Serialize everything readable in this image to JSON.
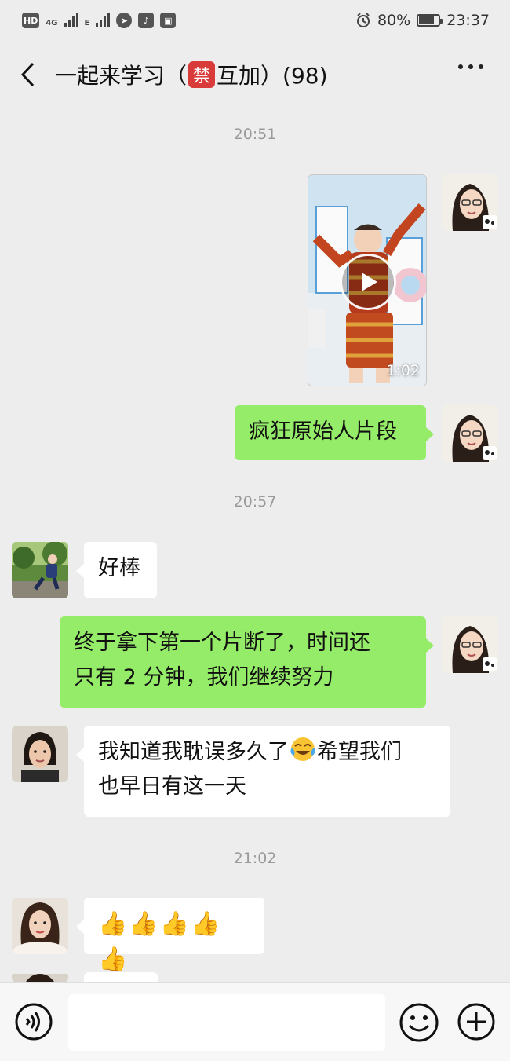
{
  "status_bar": {
    "hd": "HD",
    "net_a": "4G",
    "net_b": "E",
    "battery": "80%",
    "time": "23:37"
  },
  "header": {
    "title_before": "一起来学习（",
    "ban_badge": "禁",
    "title_after": "互加）(98)"
  },
  "chat": {
    "timestamps": [
      "20:51",
      "20:57",
      "21:02"
    ],
    "video": {
      "duration": "1:02"
    },
    "messages": [
      {
        "text": "疯狂原始人片段"
      },
      {
        "text": "好棒"
      },
      {
        "line1": "终于拿下第一个片断了，时间还",
        "line2": "只有 2 分钟，我们继续努力"
      },
      {
        "line1_before": "我知道我耽误多久了",
        "line1_after": "希望我们",
        "line2": "也早日有这一天"
      },
      {
        "text": "👍👍👍👍👍"
      }
    ]
  },
  "input_bar": {
    "placeholder": ""
  },
  "colors": {
    "self_bubble": "#95ec69",
    "other_bubble": "#ffffff",
    "background": "#ededed",
    "ban_badge": "#d93a3a"
  }
}
